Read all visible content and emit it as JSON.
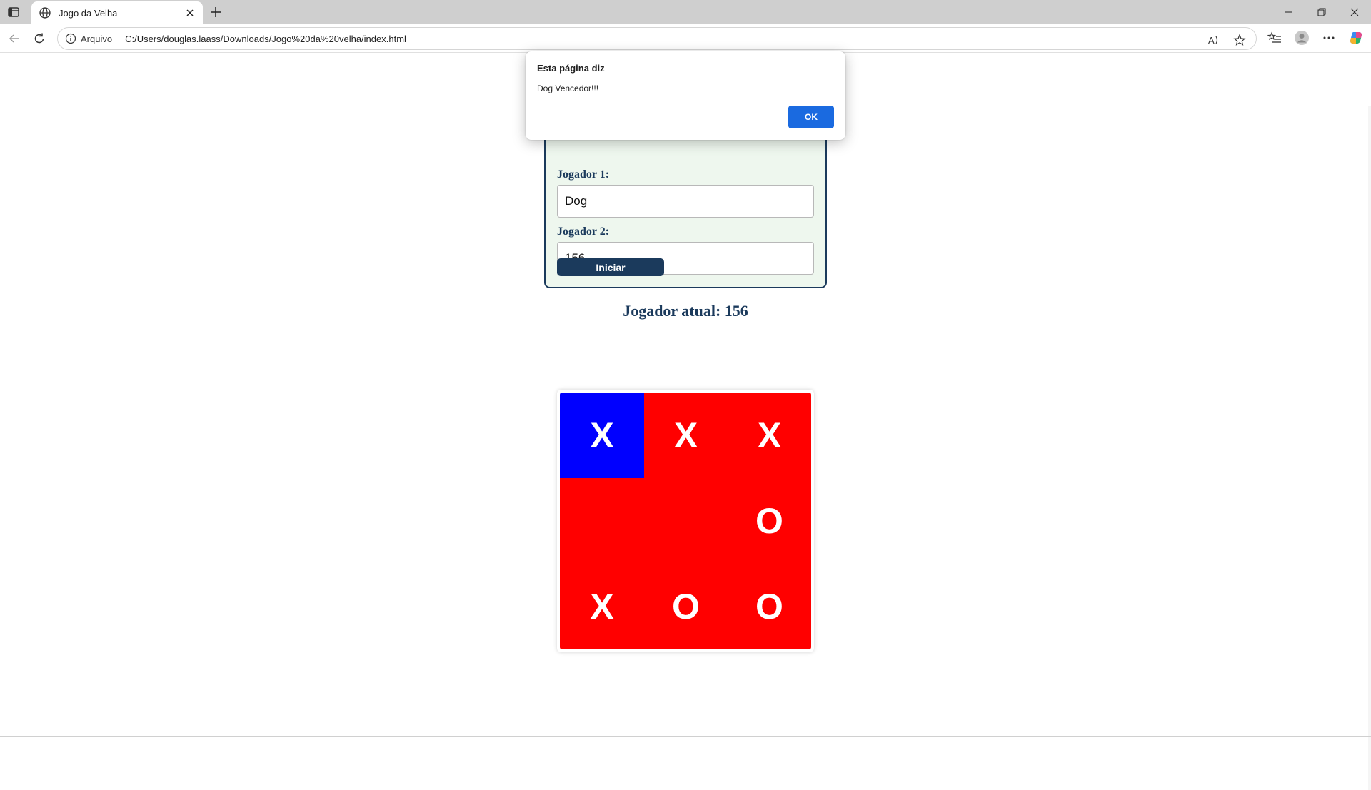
{
  "browser": {
    "tab_title": "Jogo da Velha",
    "address_scheme": "Arquivo",
    "address_url": "C:/Users/douglas.laass/Downloads/Jogo%20da%20velha/index.html"
  },
  "form": {
    "player1_label": "Jogador 1:",
    "player1_value": "Dog",
    "player2_label": "Jogador 2:",
    "player2_value": "156",
    "start_label": "Iniciar"
  },
  "status": {
    "current_player": "Jogador atual: 156"
  },
  "board": {
    "cells": [
      {
        "mark": "X",
        "color": "#0000ff"
      },
      {
        "mark": "X",
        "color": "#ff0000"
      },
      {
        "mark": "X",
        "color": "#ff0000"
      },
      {
        "mark": "",
        "color": "#ff0000"
      },
      {
        "mark": "",
        "color": "#ff0000"
      },
      {
        "mark": "O",
        "color": "#ff0000"
      },
      {
        "mark": "X",
        "color": "#ff0000"
      },
      {
        "mark": "O",
        "color": "#ff0000"
      },
      {
        "mark": "O",
        "color": "#ff0000"
      }
    ]
  },
  "dialog": {
    "title": "Esta página diz",
    "message": "Dog Vencedor!!!",
    "ok_label": "OK"
  },
  "colors": {
    "accent": "#1b3a5c",
    "form_bg": "#eef7ee",
    "dialog_button": "#1a6ae0"
  }
}
